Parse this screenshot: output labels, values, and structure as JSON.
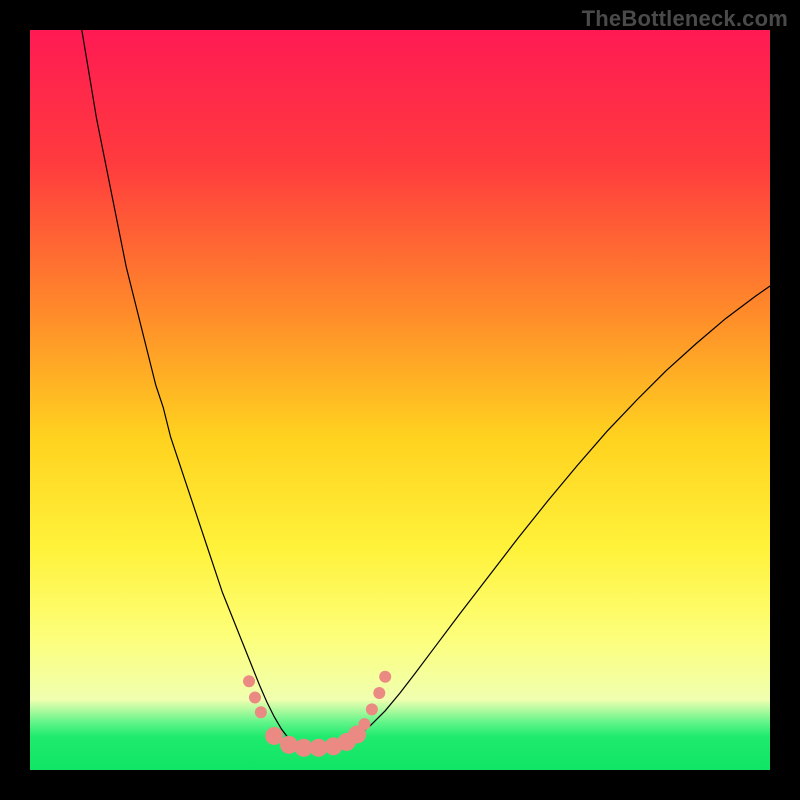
{
  "watermark": "TheBottleneck.com",
  "chart_data": {
    "type": "line",
    "title": "",
    "xlabel": "",
    "ylabel": "",
    "xlim": [
      0,
      100
    ],
    "ylim": [
      0,
      100
    ],
    "grid": false,
    "background": {
      "type": "vertical-gradient",
      "stops": [
        {
          "offset": 0.0,
          "color": "#ff1a53"
        },
        {
          "offset": 0.18,
          "color": "#ff3b3e"
        },
        {
          "offset": 0.38,
          "color": "#ff8a2a"
        },
        {
          "offset": 0.55,
          "color": "#ffd21f"
        },
        {
          "offset": 0.7,
          "color": "#fff23a"
        },
        {
          "offset": 0.82,
          "color": "#fdff7a"
        },
        {
          "offset": 0.905,
          "color": "#f0ffb0"
        },
        {
          "offset": 0.935,
          "color": "#64f58a"
        },
        {
          "offset": 0.955,
          "color": "#1feb6e"
        },
        {
          "offset": 1.0,
          "color": "#10e565"
        }
      ]
    },
    "series": [
      {
        "name": "bottleneck-curve",
        "stroke": "#000000",
        "stroke_width": 1.2,
        "x": [
          7,
          8,
          9,
          10,
          11,
          12,
          13,
          14,
          15,
          16,
          17,
          18,
          19,
          20,
          21,
          22,
          23,
          24,
          25,
          26,
          27,
          28,
          29,
          30,
          31,
          32,
          33,
          34,
          35,
          36,
          38,
          40,
          42,
          44,
          46,
          48,
          50,
          52,
          55,
          58,
          62,
          66,
          70,
          74,
          78,
          82,
          86,
          90,
          94,
          98,
          100
        ],
        "y": [
          100,
          94,
          88,
          83,
          78,
          73,
          68,
          64,
          60,
          56,
          52,
          49,
          45,
          42,
          39,
          36,
          33,
          30,
          27,
          24,
          21.5,
          19,
          16.5,
          14,
          11.5,
          9.2,
          7.2,
          5.5,
          4.2,
          3.4,
          3.0,
          3.0,
          3.4,
          4.4,
          6.0,
          8.0,
          10.4,
          13.0,
          17.0,
          21.0,
          26.2,
          31.4,
          36.4,
          41.2,
          45.8,
          50.0,
          54.0,
          57.6,
          61.0,
          64.0,
          65.4
        ]
      }
    ],
    "markers": {
      "name": "highlight-dots",
      "color": "#eb8a82",
      "radius_small": 6,
      "radius_large": 9,
      "points": [
        {
          "x": 29.6,
          "y": 12.0,
          "r": 6
        },
        {
          "x": 30.4,
          "y": 9.8,
          "r": 6
        },
        {
          "x": 31.2,
          "y": 7.8,
          "r": 6
        },
        {
          "x": 33.0,
          "y": 4.6,
          "r": 9
        },
        {
          "x": 35.0,
          "y": 3.4,
          "r": 9
        },
        {
          "x": 37.0,
          "y": 3.0,
          "r": 9
        },
        {
          "x": 39.0,
          "y": 3.0,
          "r": 9
        },
        {
          "x": 41.0,
          "y": 3.2,
          "r": 9
        },
        {
          "x": 42.8,
          "y": 3.8,
          "r": 9
        },
        {
          "x": 44.2,
          "y": 4.8,
          "r": 9
        },
        {
          "x": 45.2,
          "y": 6.2,
          "r": 6
        },
        {
          "x": 46.2,
          "y": 8.2,
          "r": 6
        },
        {
          "x": 47.2,
          "y": 10.4,
          "r": 6
        },
        {
          "x": 48.0,
          "y": 12.6,
          "r": 6
        }
      ]
    }
  }
}
